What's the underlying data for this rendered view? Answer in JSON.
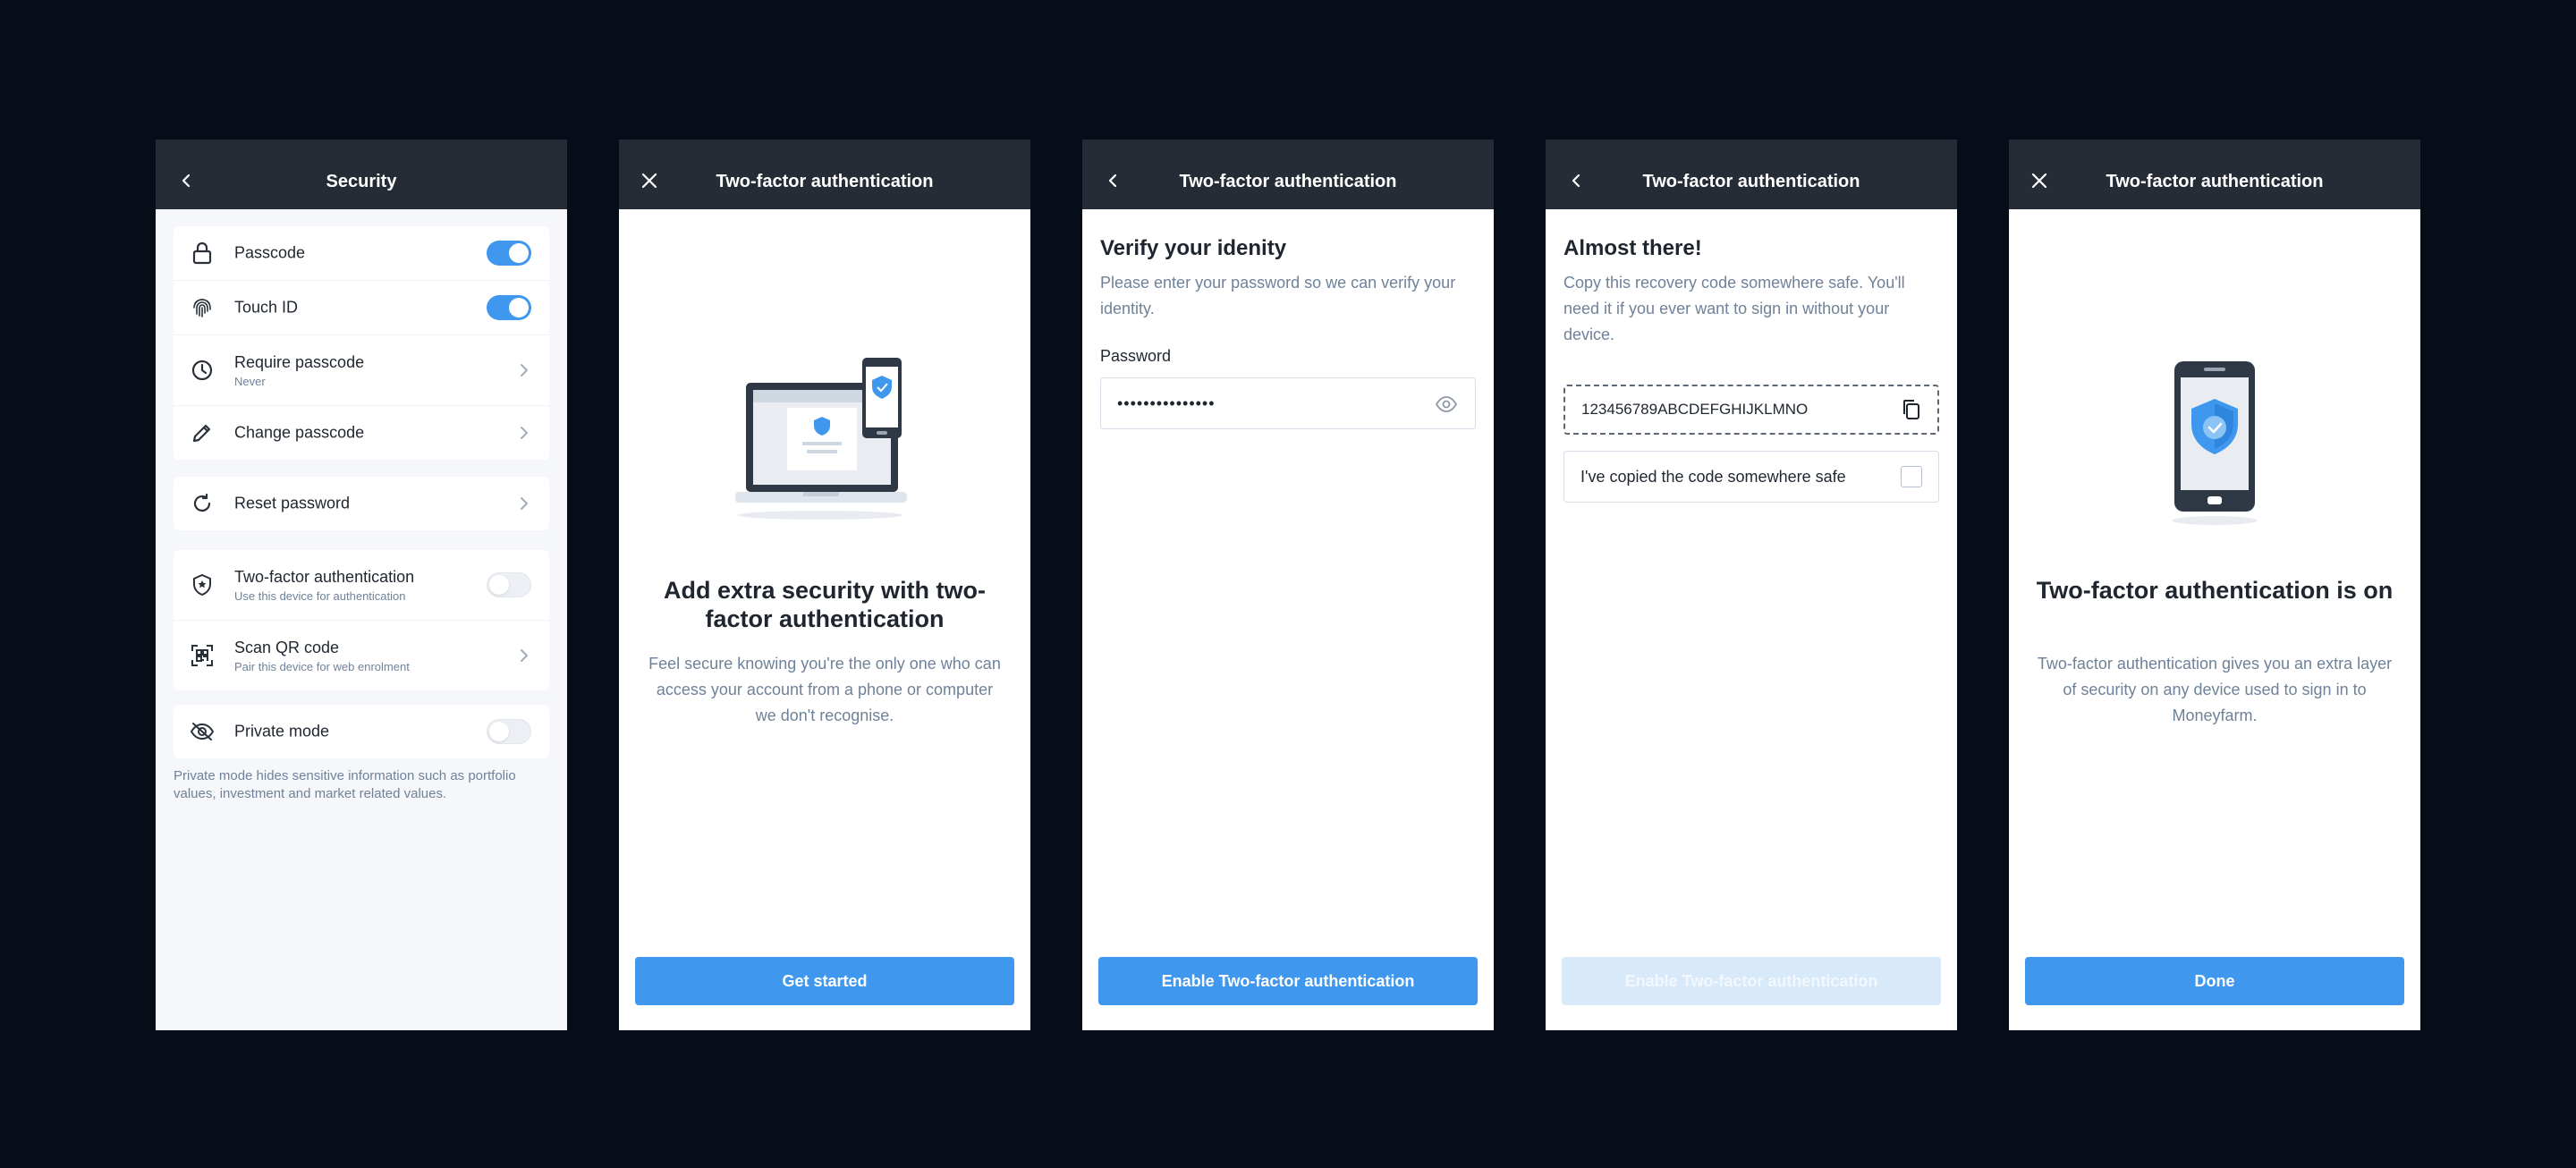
{
  "colors": {
    "background": "#070d18",
    "header": "#262c36",
    "accent": "#3f98ee",
    "muted_text": "#6f8299"
  },
  "screen1": {
    "title": "Security",
    "rows": [
      {
        "label": "Passcode",
        "icon": "lock-icon",
        "control": "toggle-on"
      },
      {
        "label": "Touch ID",
        "icon": "fingerprint-icon",
        "control": "toggle-on"
      },
      {
        "label": "Require passcode",
        "sub": "Never",
        "icon": "clock-icon",
        "control": "chevron"
      },
      {
        "label": "Change passcode",
        "icon": "pencil-icon",
        "control": "chevron"
      },
      {
        "label": "Reset password",
        "icon": "refresh-icon",
        "control": "chevron"
      },
      {
        "label": "Two-factor authentication",
        "sub": "Use this device for authentication",
        "icon": "shield-icon",
        "control": "toggle-off"
      },
      {
        "label": "Scan QR code",
        "sub": "Pair this device for web enrolment",
        "icon": "qr-scan-icon",
        "control": "chevron"
      },
      {
        "label": "Private mode",
        "icon": "eye-off-icon",
        "control": "toggle-off"
      }
    ],
    "note": "Private mode hides sensitive information such as portfolio values, investment and market related values."
  },
  "screen2": {
    "title": "Two-factor authentication",
    "heading": "Add extra security with two-factor authentication",
    "text": "Feel secure knowing you're the only one who can access your account from a phone or computer we don't recognise.",
    "button": "Get started"
  },
  "screen3": {
    "title": "Two-factor authentication",
    "heading": "Verify your idenity",
    "text": "Please enter your password so we can verify your identity.",
    "field_label": "Password",
    "field_value": "•••••••••••••••",
    "button": "Enable Two-factor authentication"
  },
  "screen4": {
    "title": "Two-factor authentication",
    "heading": "Almost there!",
    "text": "Copy this recovery code somewhere safe. You'll need it if you ever want to sign in without your device.",
    "code": "123456789ABCDEFGHIJKLMNO",
    "checkbox_label": "I've copied the code somewhere safe",
    "checkbox_checked": false,
    "button": "Enable Two-factor authentication"
  },
  "screen5": {
    "title": "Two-factor authentication",
    "heading": "Two-factor authentication is on",
    "text": "Two-factor authentication gives you an extra layer of security on any device used to sign in to Moneyfarm.",
    "button": "Done"
  }
}
